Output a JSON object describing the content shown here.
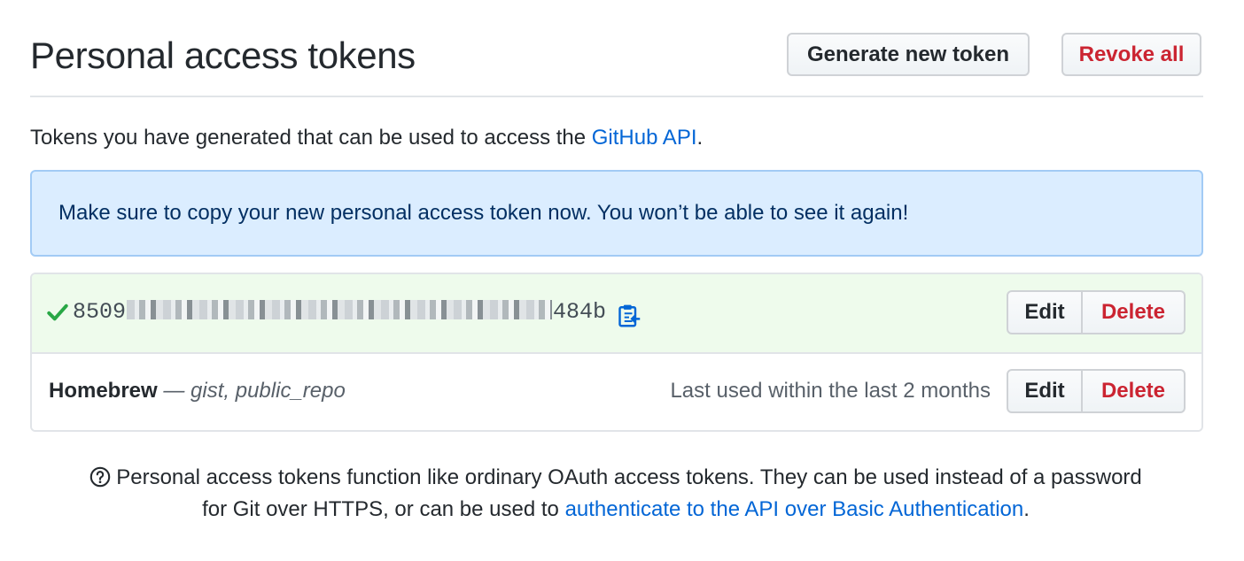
{
  "header": {
    "title": "Personal access tokens",
    "generate_label": "Generate new token",
    "revoke_label": "Revoke all"
  },
  "intro": {
    "text": "Tokens you have generated that can be used to access the ",
    "link": "GitHub API",
    "suffix": "."
  },
  "flash": {
    "message": "Make sure to copy your new personal access token now. You won’t be able to see it again!"
  },
  "tokens": [
    {
      "token_prefix": "8509",
      "token_suffix": "484b",
      "edit_label": "Edit",
      "delete_label": "Delete",
      "icons": [
        "check-icon",
        "clipboard-icon"
      ]
    },
    {
      "name": "Homebrew",
      "separator": " — ",
      "scopes": "gist, public_repo",
      "last_used": "Last used within the last 2 months",
      "edit_label": "Edit",
      "delete_label": "Delete"
    }
  ],
  "footer": {
    "line1": "Personal access tokens function like ordinary OAuth access tokens. They can be used instead of a password",
    "line2": "for Git over HTTPS, or can be used to ",
    "link": "authenticate to the API over Basic Authentication",
    "suffix": ".",
    "icon": "question-icon"
  },
  "colors": {
    "link": "#0366d6",
    "danger": "#cb2431",
    "flash_bg": "#dbedff",
    "new_token_bg": "#eefbec",
    "success": "#28a745"
  }
}
